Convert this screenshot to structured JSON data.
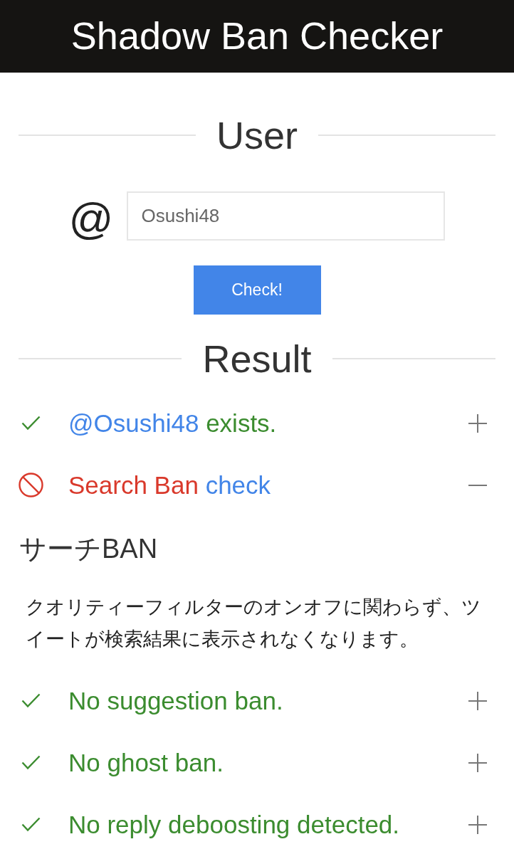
{
  "header": {
    "title": "Shadow Ban Checker"
  },
  "user_section": {
    "heading": "User",
    "at_sign": "@",
    "username_field": {
      "value": "Osushi48"
    },
    "check_button": "Check!"
  },
  "result_section": {
    "heading": "Result",
    "results": [
      {
        "kind": "pass",
        "parts": [
          {
            "text": "@Osushi48",
            "kind": "link"
          },
          {
            "text": "exists.",
            "kind": "plain"
          }
        ],
        "expanded": false
      },
      {
        "kind": "ban",
        "parts": [
          {
            "text": "Search Ban",
            "kind": "plain"
          },
          {
            "text": "check",
            "kind": "link"
          }
        ],
        "expanded": true,
        "detail": {
          "title": "サーチBAN",
          "description": "クオリティーフィルターのオンオフに関わらず、ツイートが検索結果に表示されなくなります。"
        }
      },
      {
        "kind": "pass",
        "parts": [
          {
            "text": "No suggestion ban.",
            "kind": "plain"
          }
        ],
        "expanded": false
      },
      {
        "kind": "pass",
        "parts": [
          {
            "text": "No ghost ban.",
            "kind": "plain"
          }
        ],
        "expanded": false
      },
      {
        "kind": "pass",
        "parts": [
          {
            "text": "No reply deboosting detected.",
            "kind": "plain"
          }
        ],
        "expanded": false
      }
    ]
  }
}
